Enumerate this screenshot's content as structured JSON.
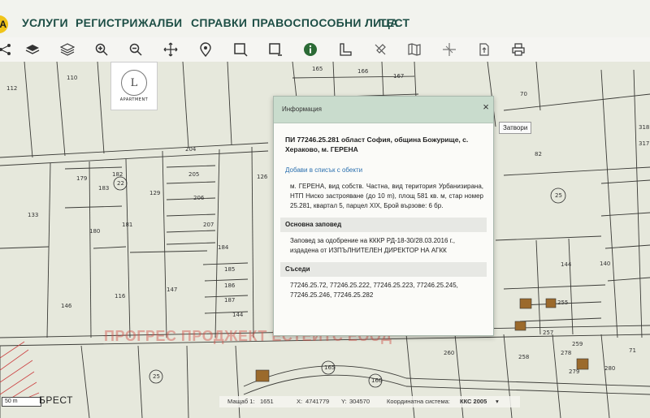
{
  "menu": {
    "logo": "A",
    "items": [
      "УСЛУГИ",
      "РЕГИСТРИ",
      "ЖАЛБИ",
      "СПРАВКИ",
      "ПРАВОСПОСОБНИ ЛИЦА",
      "ТЕСТ"
    ]
  },
  "toolbar": {
    "icons": [
      "share-icon",
      "layers-filled-icon",
      "layers-outline-icon",
      "zoom-in-icon",
      "zoom-out-icon",
      "pan-icon",
      "location-pin-icon",
      "select-area-icon",
      "select-remove-icon",
      "info-icon",
      "measure-icon",
      "tools-icon",
      "map-book-icon",
      "route-icon",
      "coordinates-icon",
      "export-icon",
      "print-icon"
    ]
  },
  "logo_card": {
    "text": "APARTMENT"
  },
  "popup": {
    "title": "Информация",
    "close_symbol": "×",
    "close_tooltip": "Затвори",
    "pi_title": "ПИ 77246.25.281 област София, община Божурище, с. Хераково, м. ГЕРЕНА",
    "add_link": "Добави в списък с обекти",
    "description": "м. ГЕРЕНА, вид собств. Частна, вид територия Урбанизирана, НТП Ниско застрояване (до 10 m), площ 581 кв. м, стар номер 25.281, квартал 5, парцел XIX, Брой вързове: 6 бр.",
    "order_heading": "Основна заповед",
    "order_text": "Заповед за одобрение на КККР РД-18-30/28.03.2016 г., издадена от ИЗПЪЛНИТЕЛЕН ДИРЕКТОР НА АГКК",
    "neighbors_heading": "Съседи",
    "neighbors_text": "77246.25.72, 77246.25.222, 77246.25.223, 77246.25.245, 77246.25.246, 77246.25.282"
  },
  "watermark": "ПРОГРЕС ПРОДЖЕКТ ЕСТЕЙТС ЕООД",
  "status": {
    "scale_label": "Мащаб 1:",
    "scale_value": "1651",
    "x_label": "X:",
    "x_value": "4741779",
    "y_label": "Y:",
    "y_value": "304570",
    "crs_label": "Координатна система:",
    "crs_value": "ККС 2005"
  },
  "scale_bar": "50 m",
  "place_name": "БРЕСТ",
  "parcels": [
    "110",
    "112",
    "165",
    "166",
    "167",
    "70",
    "318",
    "317",
    "179",
    "182",
    "183",
    "22",
    "205",
    "204",
    "206",
    "207",
    "129",
    "126",
    "133",
    "180",
    "181",
    "25",
    "184",
    "185",
    "186",
    "187",
    "144",
    "147",
    "146",
    "116",
    "82",
    "144",
    "140",
    "255",
    "257",
    "258",
    "259",
    "260",
    "25",
    "165",
    "166",
    "278",
    "279",
    "280",
    "71"
  ]
}
